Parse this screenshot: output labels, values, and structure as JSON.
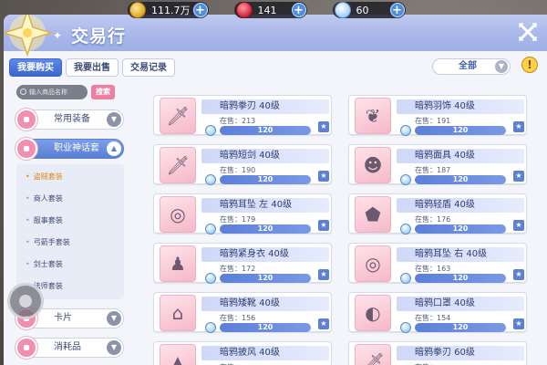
{
  "currencies": [
    {
      "icon": "gold-coin-icon",
      "value": "111.7万"
    },
    {
      "icon": "ruby-icon",
      "value": "141"
    },
    {
      "icon": "crystal-icon",
      "value": "60"
    }
  ],
  "title": "交易行",
  "tabs": [
    {
      "label": "我要购买",
      "active": true
    },
    {
      "label": "我要出售",
      "active": false
    },
    {
      "label": "交易记录",
      "active": false
    }
  ],
  "filter": {
    "label": "全部"
  },
  "search": {
    "placeholder": "输入商品名称",
    "button": "搜索"
  },
  "categories": {
    "equipment": "常用装备",
    "job_sets": "职业神话套",
    "cards": "卡片",
    "consumables": "消耗品"
  },
  "subcategories": [
    {
      "label": "盗贼套装",
      "active": true
    },
    {
      "label": "商人套装",
      "active": false
    },
    {
      "label": "服事套装",
      "active": false
    },
    {
      "label": "弓箭手套装",
      "active": false
    },
    {
      "label": "剑士套装",
      "active": false
    },
    {
      "label": "法师套装",
      "active": false
    }
  ],
  "stock_label": "在售：",
  "items": [
    {
      "name": "暗鸦拳刃 40级",
      "stock": "213",
      "price": "120",
      "icon": "fist-blade-icon"
    },
    {
      "name": "暗鸦羽饰 40级",
      "stock": "191",
      "price": "120",
      "icon": "feather-ornament-icon"
    },
    {
      "name": "暗鸦短剑 40级",
      "stock": "190",
      "price": "120",
      "icon": "dagger-icon"
    },
    {
      "name": "暗鸦面具 40级",
      "stock": "187",
      "price": "120",
      "icon": "mask-icon"
    },
    {
      "name": "暗鸦耳坠 左 40级",
      "stock": "179",
      "price": "120",
      "icon": "earring-icon"
    },
    {
      "name": "暗鸦轻盾 40级",
      "stock": "176",
      "price": "120",
      "icon": "shield-icon"
    },
    {
      "name": "暗鸦紧身衣 40级",
      "stock": "172",
      "price": "120",
      "icon": "bodysuit-icon"
    },
    {
      "name": "暗鸦耳坠 右 40级",
      "stock": "163",
      "price": "120",
      "icon": "earring-icon"
    },
    {
      "name": "暗鸦矮靴 40级",
      "stock": "156",
      "price": "120",
      "icon": "boots-icon"
    },
    {
      "name": "暗鸦口罩 40级",
      "stock": "154",
      "price": "120",
      "icon": "face-mask-icon"
    },
    {
      "name": "暗鸦披风 40级",
      "stock": "",
      "price": "",
      "icon": "cape-icon"
    },
    {
      "name": "暗鸦拳刃 60级",
      "stock": "",
      "price": "",
      "icon": "fist-blade-icon"
    }
  ],
  "colors": {
    "accent": "#3b66cc",
    "title_bar": "#a8b6ea",
    "active_sub": "#e08a20"
  }
}
